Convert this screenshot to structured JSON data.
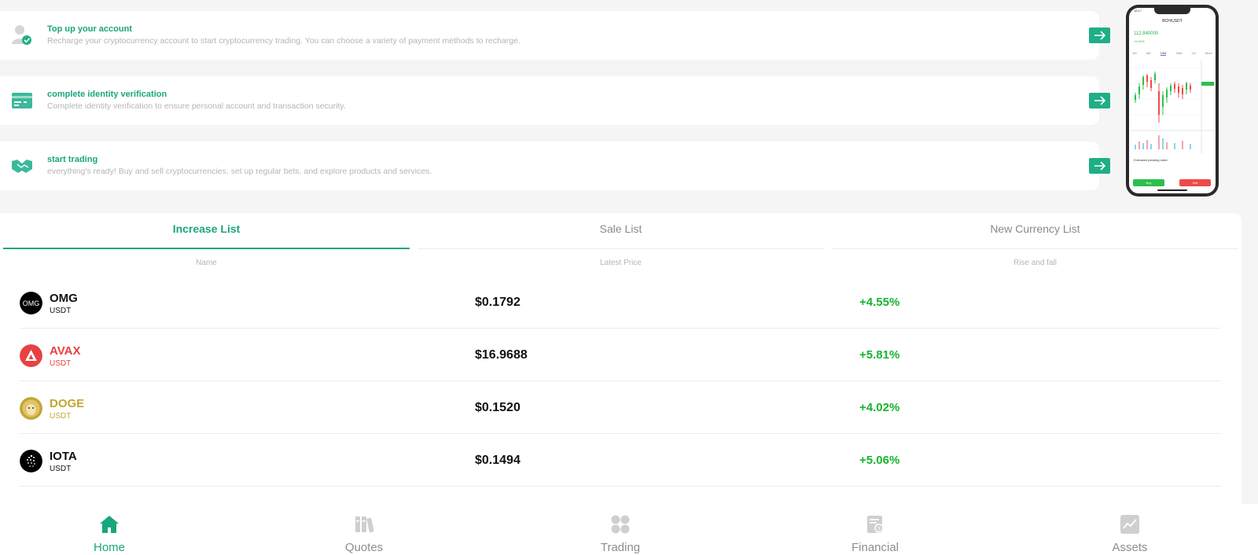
{
  "steps": [
    {
      "title": "Top up your account",
      "desc": "Recharge your cryptocurrency account to start cryptocurrency trading. You can choose a variety of payment methods to recharge.",
      "icon": "user-check-icon"
    },
    {
      "title": "complete identity verification",
      "desc": "Complete identity verification to ensure personal account and transaction security.",
      "icon": "id-card-icon"
    },
    {
      "title": "start trading",
      "desc": "everything's ready! Buy and sell cryptocurrencies, set up regular bets, and explore products and services.",
      "icon": "handshake-icon"
    }
  ],
  "phone": {
    "status_time": "18:17",
    "pair": "BCH/USDT",
    "price": "112.840000",
    "change": "+0.04%",
    "tabs": [
      "1M",
      "5M",
      "15M",
      "30M",
      "1H",
      "More"
    ],
    "order_label": "Entrusted pending order",
    "buy_label": "Buy",
    "sell_label": "Sell"
  },
  "market": {
    "tabs": [
      "Increase List",
      "Sale List",
      "New Currency List"
    ],
    "active_tab": "Increase List",
    "columns": {
      "name": "Name",
      "price": "Latest Price",
      "change": "Rise and fall"
    },
    "rows": [
      {
        "symbol": "OMG",
        "quote": "USDT",
        "price": "$0.1792",
        "change": "+4.55%",
        "color": "#111111",
        "icon": "omg-coin-icon"
      },
      {
        "symbol": "AVAX",
        "quote": "USDT",
        "price": "$16.9688",
        "change": "+5.81%",
        "color": "#e84142",
        "icon": "avax-coin-icon"
      },
      {
        "symbol": "DOGE",
        "quote": "USDT",
        "price": "$0.1520",
        "change": "+4.02%",
        "color": "#c2a633",
        "icon": "doge-coin-icon"
      },
      {
        "symbol": "IOTA",
        "quote": "USDT",
        "price": "$0.1494",
        "change": "+5.06%",
        "color": "#111111",
        "icon": "iota-coin-icon"
      }
    ]
  },
  "nav": [
    {
      "label": "Home",
      "icon": "home-icon",
      "active": true
    },
    {
      "label": "Quotes",
      "icon": "quotes-icon",
      "active": false
    },
    {
      "label": "Trading",
      "icon": "trading-icon",
      "active": false
    },
    {
      "label": "Financial",
      "icon": "financial-icon",
      "active": false
    },
    {
      "label": "Assets",
      "icon": "assets-icon",
      "active": false
    }
  ],
  "colors": {
    "accent": "#1aa57e",
    "positive": "#18b42f"
  }
}
